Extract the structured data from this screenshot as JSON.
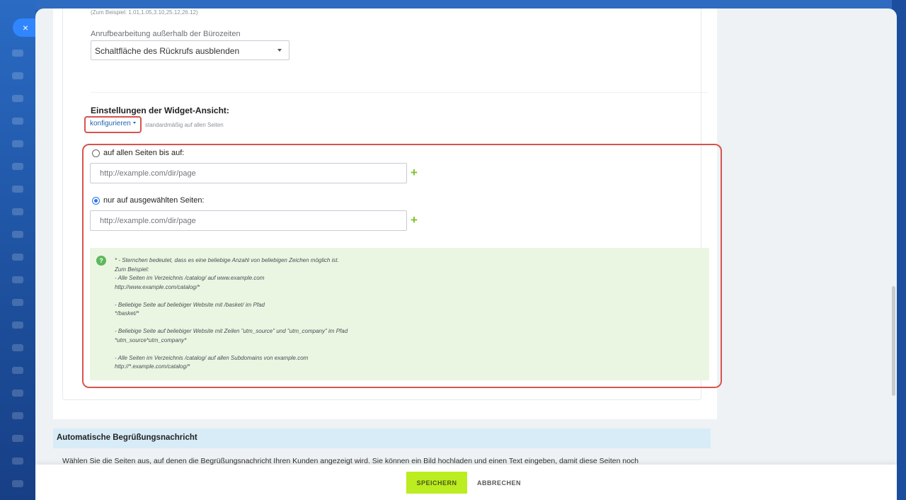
{
  "close_glyph": "×",
  "hint_top": "(Zum Beispiel: 1.01,1.05,3.10,25.12,26.12)",
  "after_hours": {
    "label": "Anrufbearbeitung außerhalb der Bürozeiten",
    "selected": "Schaltfläche des Rückrufs ausblenden"
  },
  "widget_view": {
    "title": "Einstellungen der Widget-Ansicht:",
    "configure_link": "konfigurieren",
    "default_note": "standardmäßig auf allen Seiten",
    "option_all_except": "auf allen Seiten bis auf:",
    "option_selected_only": "nur auf ausgewählten Seiten:",
    "url_placeholder": "http://example.com/dir/page",
    "plus_glyph": "+",
    "selected_option": "nur auf ausgewählten Seiten:"
  },
  "help": {
    "icon_glyph": "?",
    "text": "* - Sternchen bedeutet, dass es eine beliebige Anzahl von beliebigen Zeichen möglich ist.\nZum Beispiel:\n- Alle Seiten im Verzeichnis /catalog/ auf www.example.com\nhttp://www.example.com/catalog/*\n\n- Beliebige Seite auf beliebiger Website mit /basket/ im Pfad\n*/basket/*\n\n- Beliebige Seite auf beliebiger Website mit Zeilen \"utm_source\" und \"utm_company\" im Pfad\n*utm_source*utm_company*\n\n- Alle Seiten im Verzeichnis /catalog/ auf allen Subdomains von example.com\nhttp://*.example.com/catalog/*"
  },
  "greeting": {
    "title": "Automatische Begrüßungsnachricht",
    "text": "Wählen Sie die Seiten aus, auf denen die Begrüßungsnachricht Ihren Kunden angezeigt wird. Sie können ein Bild hochladen und einen Text eingeben, damit diese Seiten noch"
  },
  "footer": {
    "save_label": "SPEICHERN",
    "cancel_label": "ABBRECHEN"
  },
  "colors": {
    "accent_save": "#bbed21",
    "highlight_frame": "#d9534f",
    "help_bg": "#ebf6e2",
    "link": "#2067b0"
  }
}
